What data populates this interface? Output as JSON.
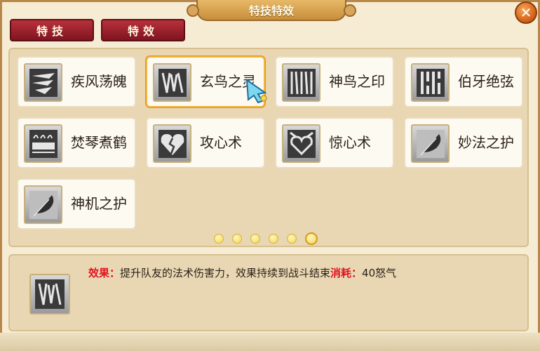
{
  "window": {
    "title": "特技特效",
    "close_icon": "close-x-icon"
  },
  "tabs": [
    {
      "label": "特技",
      "active": true
    },
    {
      "label": "特效",
      "active": false
    }
  ],
  "skills": [
    {
      "name": "疾风荡魄",
      "icon": "wind-slash-icon",
      "selected": false
    },
    {
      "name": "玄鸟之灵",
      "icon": "dark-bird-icon",
      "selected": true
    },
    {
      "name": "神鸟之印",
      "icon": "divine-bird-seal-icon",
      "selected": false
    },
    {
      "name": "伯牙绝弦",
      "icon": "broken-strings-icon",
      "selected": false
    },
    {
      "name": "焚琴煮鹤",
      "icon": "burning-zither-icon",
      "selected": false
    },
    {
      "name": "攻心术",
      "icon": "broken-heart-icon",
      "selected": false
    },
    {
      "name": "惊心术",
      "icon": "shocked-heart-icon",
      "selected": false
    },
    {
      "name": "妙法之护",
      "icon": "feather-icon",
      "selected": false
    },
    {
      "name": "神机之护",
      "icon": "feather-icon",
      "selected": false
    }
  ],
  "pagination": {
    "pages": 6,
    "current": 6
  },
  "description": {
    "effect_label": "效果：",
    "effect_text": "提升队友的法术伤害力，效果持续到战斗结束",
    "cost_label": "消耗：",
    "cost_value": "40怒气",
    "icon": "dark-bird-icon"
  },
  "colors": {
    "tab_red": "#9b1f2b",
    "gold": "#c78e3c",
    "highlight_text": "#e0141f",
    "selected_border": "#f2b43a"
  }
}
